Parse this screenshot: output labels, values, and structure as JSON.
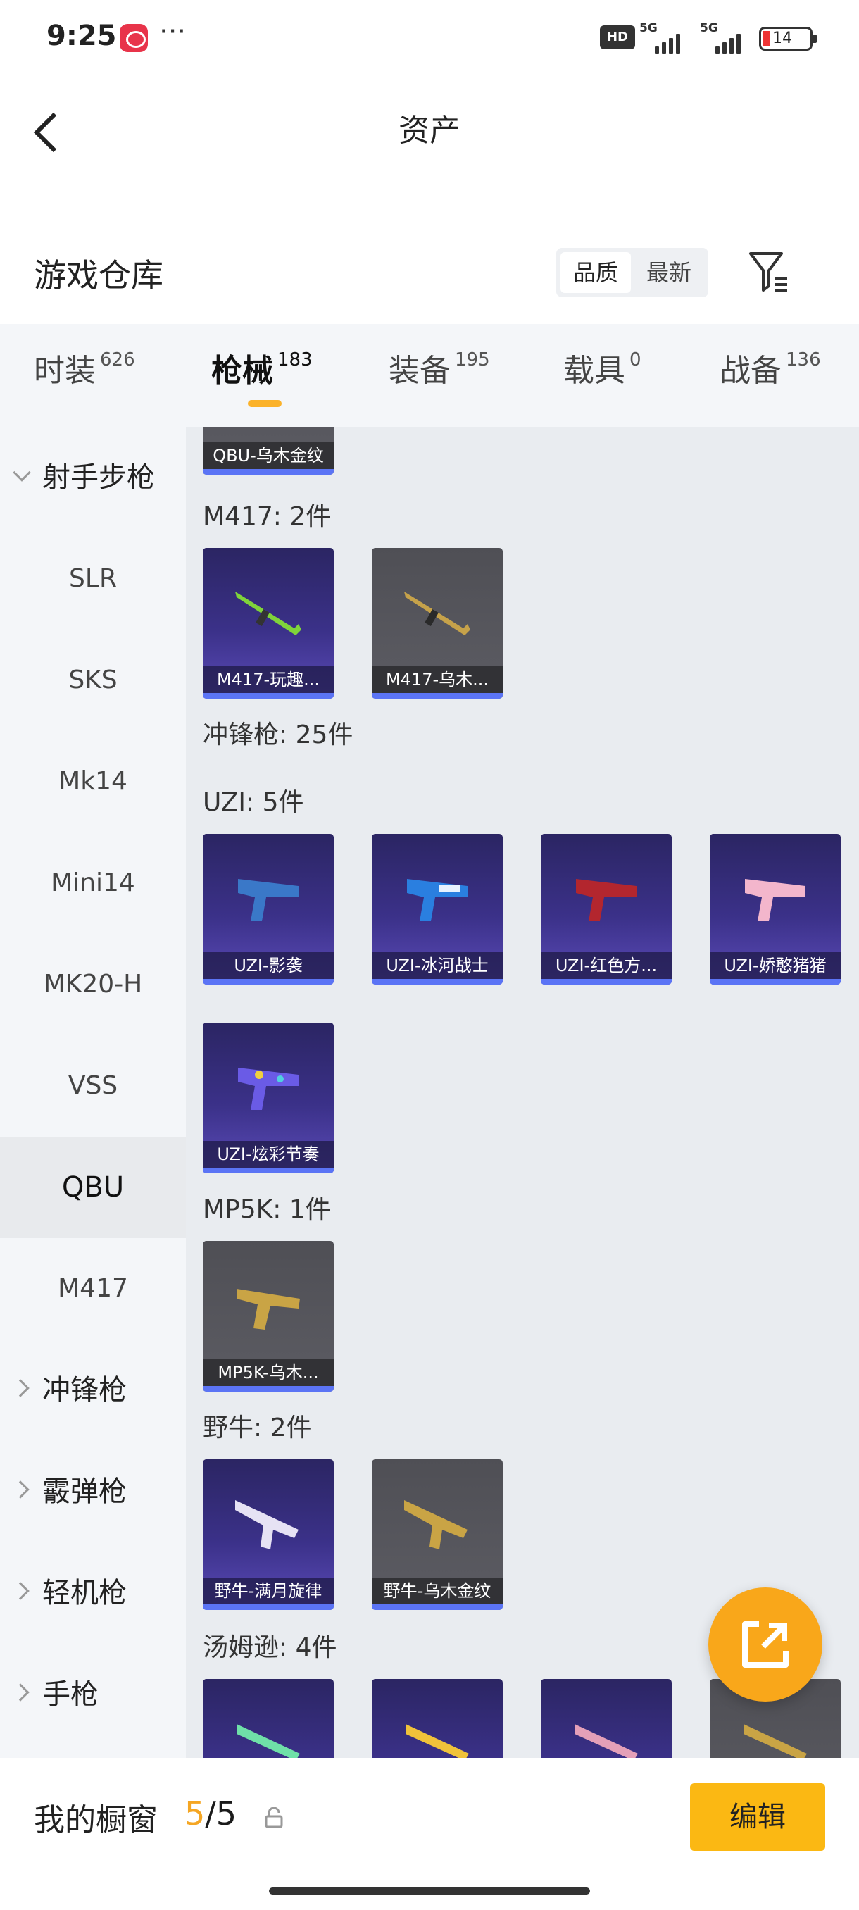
{
  "status_bar": {
    "time": "9:25",
    "more": "···",
    "hd": "HD",
    "net1": "5G",
    "net2": "5G",
    "battery": "14"
  },
  "header": {
    "title": "资产"
  },
  "section": {
    "title": "游戏仓库",
    "sort_options": [
      "品质",
      "最新"
    ],
    "sort_selected": "品质"
  },
  "tabs": [
    {
      "label": "时装",
      "count": "626"
    },
    {
      "label": "枪械",
      "count": "183",
      "active": true
    },
    {
      "label": "装备",
      "count": "195"
    },
    {
      "label": "载具",
      "count": "0"
    },
    {
      "label": "战备",
      "count": "136"
    }
  ],
  "sidebar": {
    "group_open": "射手步枪",
    "items": [
      "SLR",
      "SKS",
      "Mk14",
      "Mini14",
      "MK20-H",
      "VSS",
      "QBU",
      "M417"
    ],
    "active_item": "QBU",
    "groups_closed": [
      "冲锋枪",
      "霰弹枪",
      "轻机枪",
      "手枪"
    ]
  },
  "content": {
    "top_card": "QBU-乌木金纹",
    "groups": [
      {
        "label": "M417: 2件",
        "cards": [
          {
            "name": "M417-玩趣...",
            "style": "purple"
          },
          {
            "name": "M417-乌木...",
            "style": "gray"
          }
        ]
      },
      {
        "label": "冲锋枪: 25件",
        "cards": []
      },
      {
        "label": "UZI: 5件",
        "cards": [
          {
            "name": "UZI-影袭",
            "style": "purple"
          },
          {
            "name": "UZI-冰河战士",
            "style": "purple"
          },
          {
            "name": "UZI-红色方...",
            "style": "purple"
          },
          {
            "name": "UZI-娇憨猪猪",
            "style": "purple"
          },
          {
            "name": "UZI-炫彩节奏",
            "style": "purple"
          }
        ]
      },
      {
        "label": "MP5K: 1件",
        "cards": [
          {
            "name": "MP5K-乌木...",
            "style": "gray"
          }
        ]
      },
      {
        "label": "野牛: 2件",
        "cards": [
          {
            "name": "野牛-满月旋律",
            "style": "purple"
          },
          {
            "name": "野牛-乌木金纹",
            "style": "gray"
          }
        ]
      },
      {
        "label": "汤姆逊: 4件",
        "cards": []
      }
    ]
  },
  "bottom": {
    "showcase_label": "我的橱窗",
    "current": "5",
    "separator": "/",
    "total": "5",
    "edit_button": "编辑"
  },
  "colors": {
    "accent": "#fbb813",
    "tab_indicator": "#fbb22a",
    "card_bar": "#5b74f5",
    "fab": "#f9a71a"
  }
}
